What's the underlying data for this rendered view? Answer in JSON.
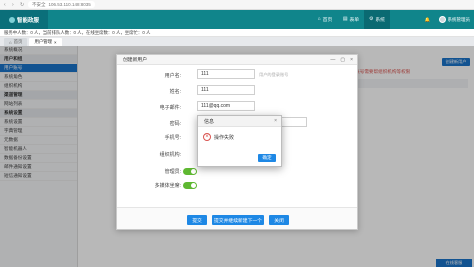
{
  "browser": {
    "security_label": "不安全",
    "url": "106.53.110.148:8035"
  },
  "app": {
    "logo_text": "智能政服",
    "tabs": [
      {
        "label": "首页",
        "icon": "home-icon"
      },
      {
        "label": "表单",
        "icon": "form-icon"
      },
      {
        "label": "系统",
        "icon": "gear-icon"
      }
    ],
    "user_menu": "系统管理员",
    "messages_label": "消息"
  },
  "info_strip": {
    "text": "服务中人数：0 人，当前排队人数：0 人，在线坐席数：0 人，坐席忙：0 人"
  },
  "breadcrumbs": [
    {
      "label": "首页"
    },
    {
      "label": "用户管理"
    }
  ],
  "sidebar": {
    "items": [
      {
        "label": "系统概况",
        "type": "item"
      },
      {
        "label": "用户和组",
        "type": "group"
      },
      {
        "label": "用户账号",
        "type": "item",
        "active": true
      },
      {
        "label": "系统角色",
        "type": "item"
      },
      {
        "label": "组织机构",
        "type": "item"
      },
      {
        "label": "渠道管理",
        "type": "group"
      },
      {
        "label": "网站列表",
        "type": "item"
      },
      {
        "label": "系统设置",
        "type": "group"
      },
      {
        "label": "系统设置",
        "type": "item"
      },
      {
        "label": "字典管理",
        "type": "item"
      },
      {
        "label": "元数据",
        "type": "item"
      },
      {
        "label": "智能机器人",
        "type": "item"
      },
      {
        "label": "数据备份设置",
        "type": "item"
      },
      {
        "label": "邮件通知设置",
        "type": "item"
      },
      {
        "label": "短信通知设置",
        "type": "item"
      }
    ]
  },
  "background_page": {
    "warning": "若管理员账号，设置后，该账号需要帮组织机构等权限",
    "new_user_button": "创建新用户",
    "table_headers": [
      "多媒体",
      "管理员",
      "操作"
    ],
    "float_button": "在线客服"
  },
  "create_user_modal": {
    "title": "创建新用户",
    "fields": {
      "username": {
        "label": "用户名:",
        "value": "111",
        "hint": "用户的登录账号"
      },
      "nickname": {
        "label": "姓名:",
        "value": "111"
      },
      "email": {
        "label": "电子邮件:",
        "value": "111@qq.com"
      },
      "password": {
        "label": "密码:",
        "value": "•••••"
      },
      "phone": {
        "label": "手机号:",
        "value": "15"
      },
      "org": {
        "label": "组织机构:",
        "value": "集团"
      },
      "admin": {
        "label": "管理员:"
      },
      "multimedia": {
        "label": "多媒体坐席:"
      }
    },
    "submit_label": "提交",
    "submit_next_label": "提交并继续新建下一个",
    "close_label": "关闭"
  },
  "info_dialog": {
    "title": "信息",
    "message": "操作失败",
    "ok_label": "确定"
  },
  "colors": {
    "header": "#10858b",
    "active_blue": "#1a73c9",
    "toggle_on": "#5fb832",
    "error_red": "#d9534f"
  }
}
